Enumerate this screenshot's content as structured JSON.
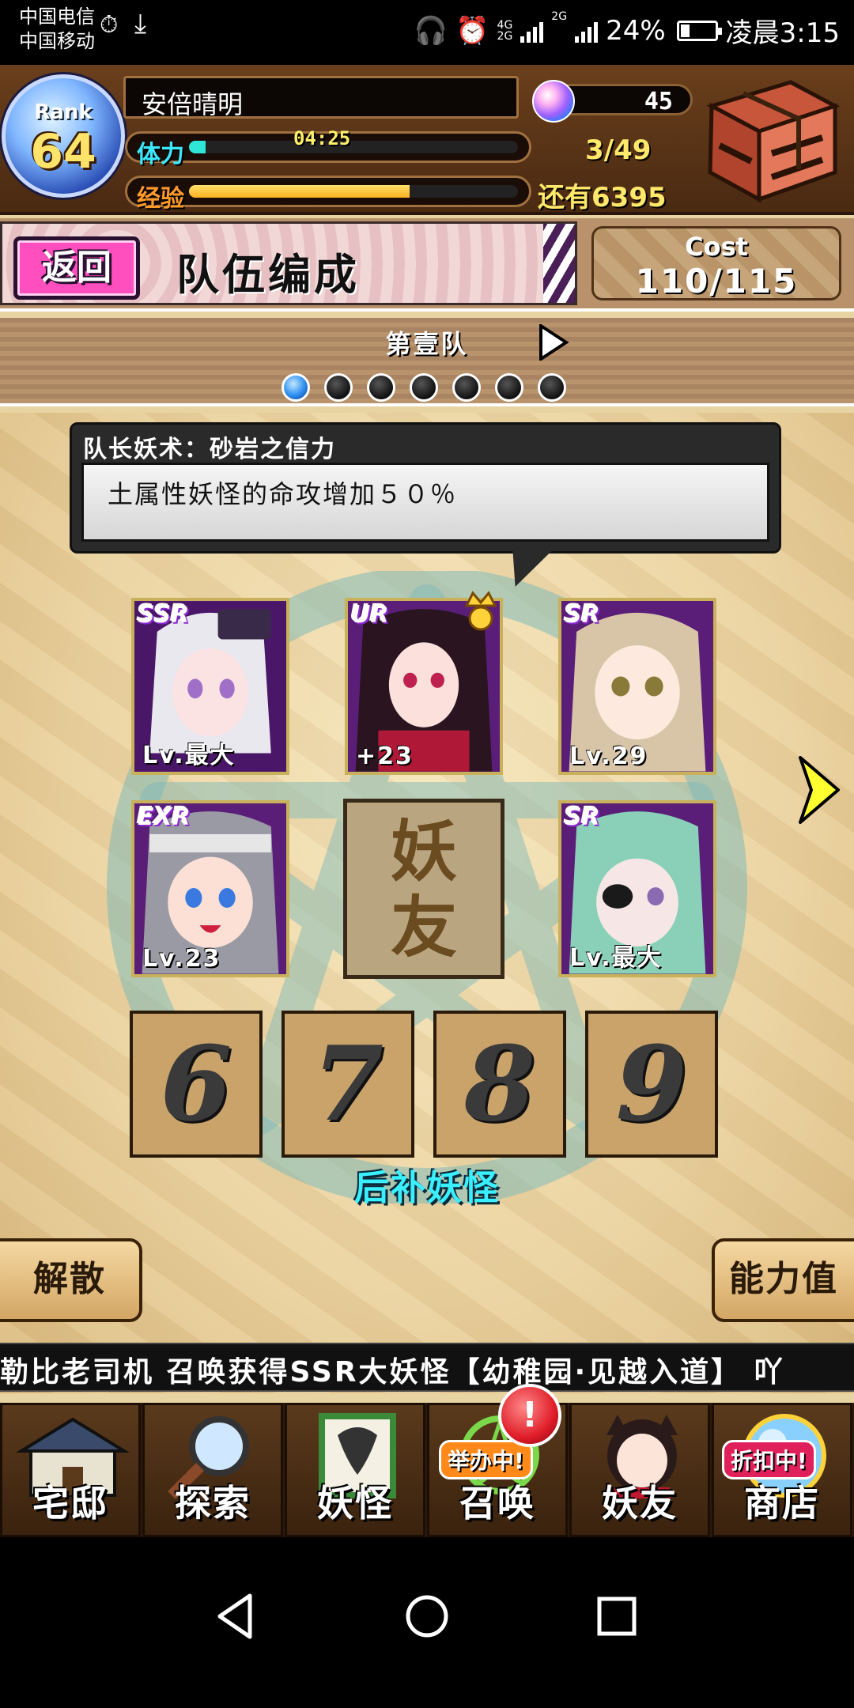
{
  "status_bar": {
    "carrier_1": "中国电信",
    "carrier_2": "中国移动",
    "network_1": "4G",
    "network_2": "2G",
    "network_3": "2G",
    "battery": "24%",
    "time": "凌晨3:15"
  },
  "player": {
    "rank_label": "Rank",
    "rank": "64",
    "name": "安倍晴明",
    "stamina_label": "体力",
    "stamina_timer": "04:25",
    "stamina_fill": 0.05,
    "exp_label": "经验",
    "exp_fill": 0.67,
    "gems": "45",
    "monster_count": "3/49",
    "exp_remaining": "还有6395"
  },
  "header": {
    "back_label": "返回",
    "title": "队伍编成",
    "cost_label": "Cost",
    "cost_value": "110/115"
  },
  "team": {
    "name": "第壹队",
    "page_count": 7,
    "active_page": 1
  },
  "leader_skill": {
    "title": "队长妖术：砂岩之信力",
    "description": "土属性妖怪的命攻增加５０％"
  },
  "cards": [
    {
      "rarity": "SSR",
      "level": "Lv.最大"
    },
    {
      "rarity": "UR",
      "level": "+23"
    },
    {
      "rarity": "SR",
      "level": "Lv.29"
    },
    {
      "rarity": "EXR",
      "level": "Lv.23"
    },
    {
      "rarity": "SR",
      "level": "Lv.最大"
    }
  ],
  "friend_slot": {
    "char_1": "妖",
    "char_2": "友"
  },
  "reserve": {
    "slots": [
      "6",
      "7",
      "8",
      "9"
    ],
    "label": "后补妖怪"
  },
  "buttons": {
    "disband": "解散",
    "stats": "能力值"
  },
  "ticker": "勒比老司机 召唤获得SSR大妖怪【幼稚园·见越入道】 吖",
  "nav": {
    "items": [
      "宅邸",
      "探索",
      "妖怪",
      "召唤",
      "妖友",
      "商店"
    ],
    "summon_badge": "举办中!",
    "shop_badge": "折扣中!",
    "alert": "!"
  },
  "colors": {
    "stamina_bar": "#2ee6d8",
    "exp_bar": "#ffb020",
    "ssr_card": "#5a1e78",
    "reserve_label": "#3af0ff"
  }
}
